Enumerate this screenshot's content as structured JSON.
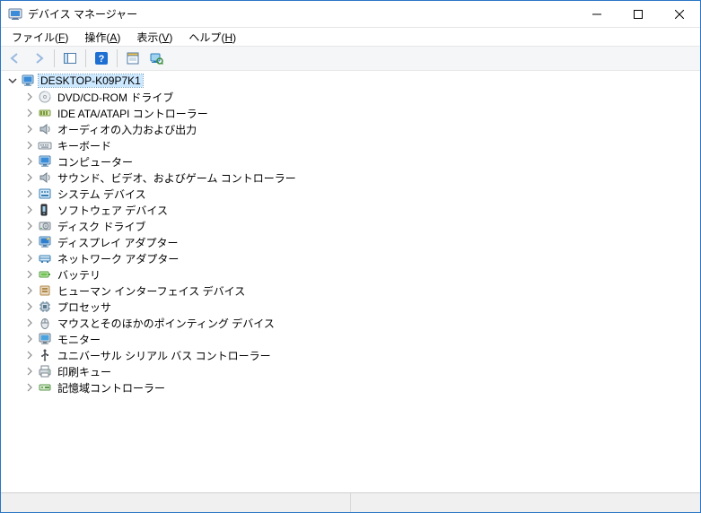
{
  "title": "デバイス マネージャー",
  "menus": {
    "file": {
      "label": "ファイル",
      "accel": "F"
    },
    "action": {
      "label": "操作",
      "accel": "A"
    },
    "view": {
      "label": "表示",
      "accel": "V"
    },
    "help": {
      "label": "ヘルプ",
      "accel": "H"
    }
  },
  "toolbar": {
    "back": "戻る",
    "forward": "進む",
    "show_hide_tree": "コンソール ツリーの表示/非表示",
    "help": "ヘルプ",
    "properties": "プロパティ",
    "scan": "ハードウェア変更のスキャン"
  },
  "tree": {
    "root": {
      "label": "DESKTOP-K09P7K1",
      "icon": "computer-icon",
      "expanded": true
    },
    "children": [
      {
        "label": "DVD/CD-ROM ドライブ",
        "icon": "disc-icon"
      },
      {
        "label": "IDE ATA/ATAPI コントローラー",
        "icon": "ide-icon"
      },
      {
        "label": "オーディオの入力および出力",
        "icon": "speaker-icon"
      },
      {
        "label": "キーボード",
        "icon": "keyboard-icon"
      },
      {
        "label": "コンピューター",
        "icon": "computer-icon"
      },
      {
        "label": "サウンド、ビデオ、およびゲーム コントローラー",
        "icon": "speaker-icon"
      },
      {
        "label": "システム デバイス",
        "icon": "system-icon"
      },
      {
        "label": "ソフトウェア デバイス",
        "icon": "software-icon"
      },
      {
        "label": "ディスク ドライブ",
        "icon": "disk-icon"
      },
      {
        "label": "ディスプレイ アダプター",
        "icon": "display-icon"
      },
      {
        "label": "ネットワーク アダプター",
        "icon": "network-icon"
      },
      {
        "label": "バッテリ",
        "icon": "battery-icon"
      },
      {
        "label": "ヒューマン インターフェイス デバイス",
        "icon": "hid-icon"
      },
      {
        "label": "プロセッサ",
        "icon": "processor-icon"
      },
      {
        "label": "マウスとそのほかのポインティング デバイス",
        "icon": "mouse-icon"
      },
      {
        "label": "モニター",
        "icon": "monitor-icon"
      },
      {
        "label": "ユニバーサル シリアル バス コントローラー",
        "icon": "usb-icon"
      },
      {
        "label": "印刷キュー",
        "icon": "printer-icon"
      },
      {
        "label": "記憶域コントローラー",
        "icon": "storage-icon"
      }
    ]
  }
}
